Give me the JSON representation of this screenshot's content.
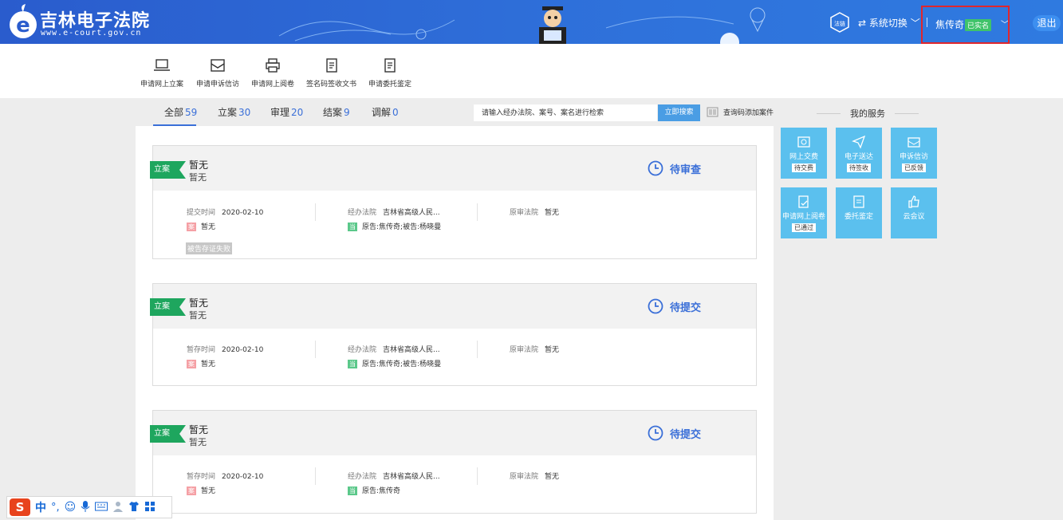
{
  "header": {
    "title": "吉林电子法院",
    "url": "www.e-court.gov.cn",
    "fa_label": "法链",
    "system_switch": "系统切换",
    "user_name": "焦传奇",
    "real_name_badge": "已实名",
    "logout": "退出"
  },
  "toolbar": {
    "items": [
      {
        "label": "申请网上立案",
        "icon": "laptop-icon"
      },
      {
        "label": "申请申诉信访",
        "icon": "envelope-icon"
      },
      {
        "label": "申请网上阅卷",
        "icon": "printer-icon"
      },
      {
        "label": "签名码签收文书",
        "icon": "document-edit-icon"
      },
      {
        "label": "申请委托鉴定",
        "icon": "document-edit-icon"
      }
    ]
  },
  "tabs": [
    {
      "label": "全部",
      "count": "59",
      "active": true
    },
    {
      "label": "立案",
      "count": "30"
    },
    {
      "label": "审理",
      "count": "20"
    },
    {
      "label": "结案",
      "count": "9"
    },
    {
      "label": "调解",
      "count": "0"
    }
  ],
  "search": {
    "placeholder": "请输入经办法院、案号、案名进行检索",
    "button": "立即搜索",
    "qr_link": "查询码添加案件"
  },
  "cases": [
    {
      "ribbon": "立案",
      "title": "暂无",
      "subtitle": "暂无",
      "status": "待审查",
      "time_label": "提交时间",
      "time_value": "2020-02-10",
      "case_tag": "案",
      "case_value": "暂无",
      "court_label": "经办法院",
      "court_value": "吉林省高级人民...",
      "party_tag": "当",
      "party_value": "原告:焦传奇;被告:杨晓曼",
      "orig_court_label": "原审法院",
      "orig_court_value": "暂无",
      "extra_chip": "被告存证失败"
    },
    {
      "ribbon": "立案",
      "title": "暂无",
      "subtitle": "暂无",
      "status": "待提交",
      "time_label": "暂存时间",
      "time_value": "2020-02-10",
      "case_tag": "案",
      "case_value": "暂无",
      "court_label": "经办法院",
      "court_value": "吉林省高级人民...",
      "party_tag": "当",
      "party_value": "原告:焦传奇;被告:杨晓曼",
      "orig_court_label": "原审法院",
      "orig_court_value": "暂无"
    },
    {
      "ribbon": "立案",
      "title": "暂无",
      "subtitle": "暂无",
      "status": "待提交",
      "time_label": "暂存时间",
      "time_value": "2020-02-10",
      "case_tag": "案",
      "case_value": "暂无",
      "court_label": "经办法院",
      "court_value": "吉林省高级人民...",
      "party_tag": "当",
      "party_value": "原告:焦传奇",
      "orig_court_label": "原审法院",
      "orig_court_value": "暂无"
    }
  ],
  "services": {
    "title": "我的服务",
    "items": [
      {
        "label": "网上交费",
        "badge": "待交费",
        "icon": "payment-icon"
      },
      {
        "label": "电子送达",
        "badge": "待签收",
        "icon": "paper-plane-icon"
      },
      {
        "label": "申诉信访",
        "badge": "已反馈",
        "icon": "envelope-icon"
      },
      {
        "label": "申请网上阅卷",
        "badge": "已通过",
        "icon": "document-check-icon"
      },
      {
        "label": "委托鉴定",
        "icon": "document-edit-icon"
      },
      {
        "label": "云会议",
        "icon": "thumbs-up-icon"
      }
    ]
  },
  "ime": {
    "logo": "S",
    "mode": "中",
    "punct": "°,"
  },
  "colors": {
    "header_blue": "#2f72db",
    "accent_blue": "#3a6fd8",
    "ribbon_green": "#1ea65e",
    "service_tile": "#5bc0ee",
    "highlight_red": "#e0262c"
  }
}
